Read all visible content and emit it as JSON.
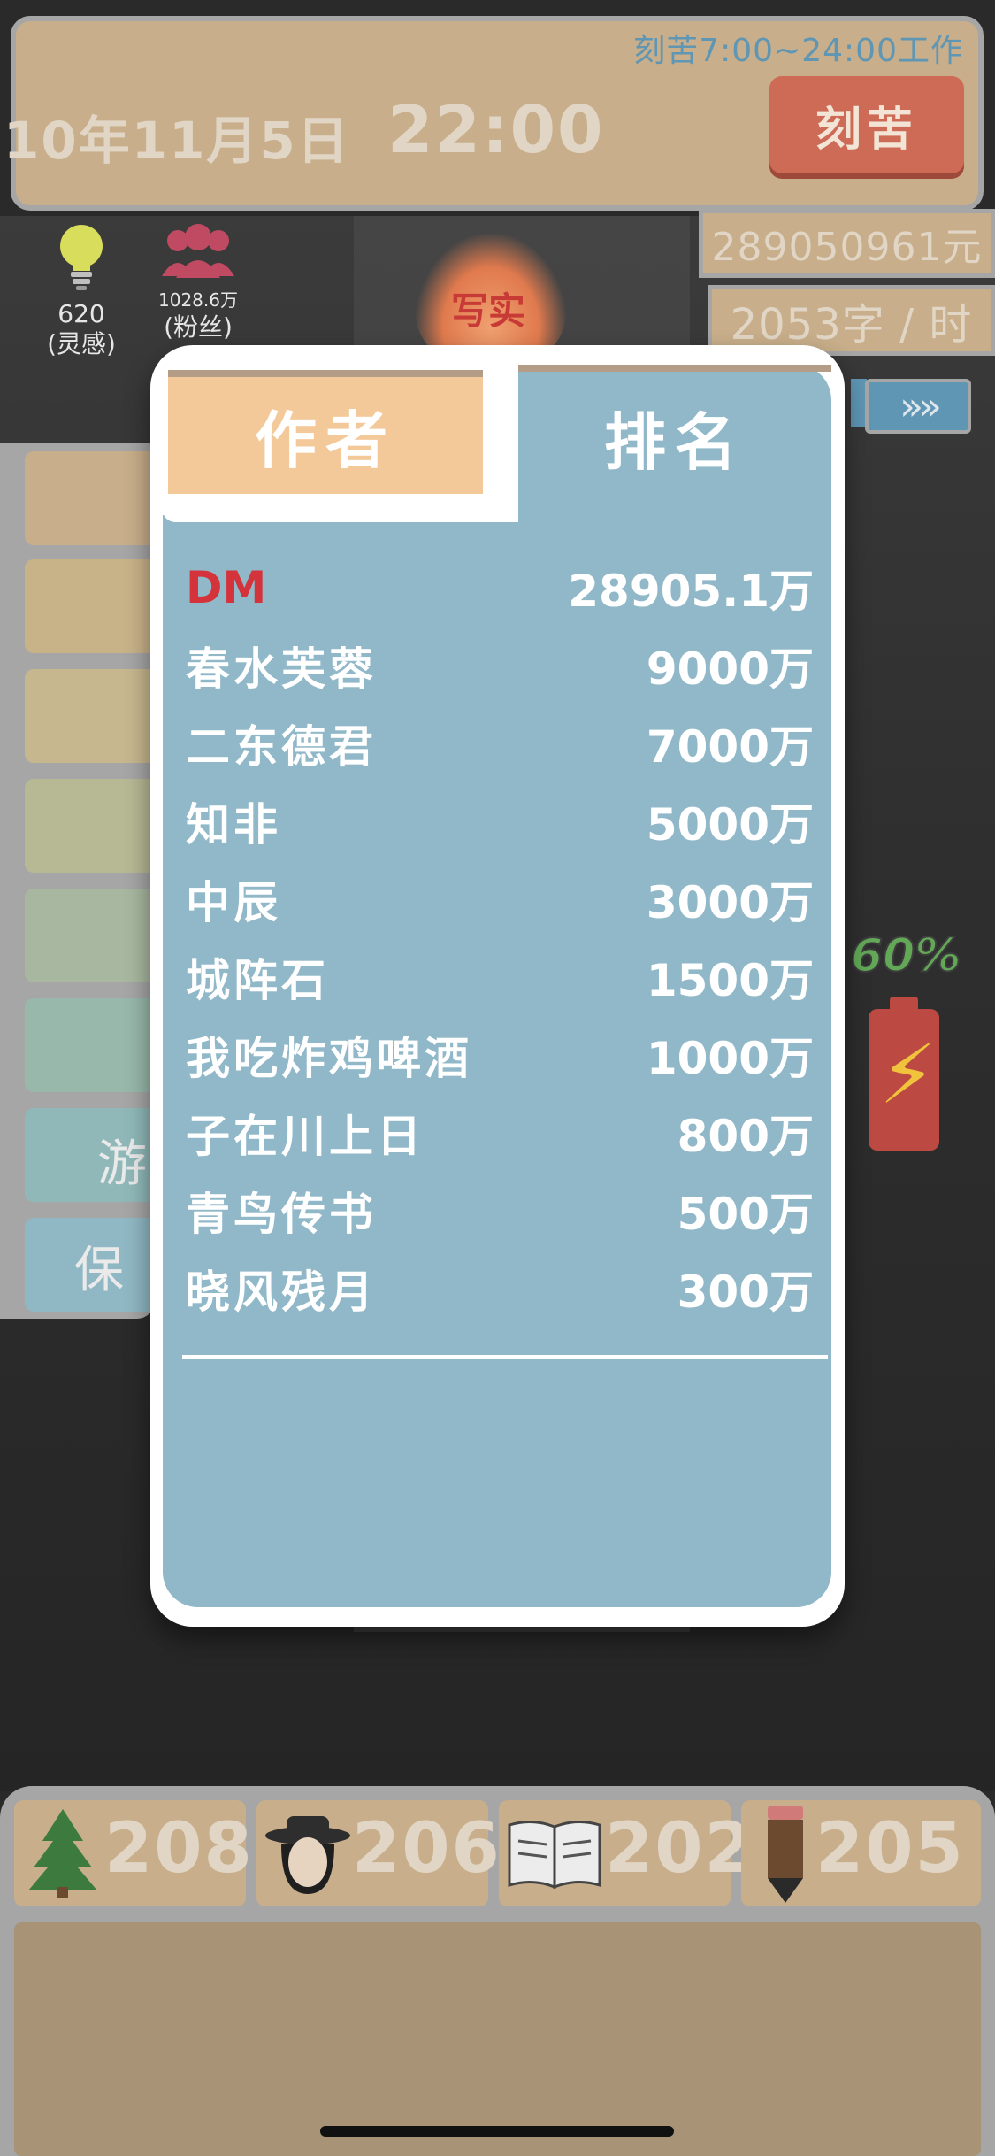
{
  "header": {
    "work_hours": "刻苦7:00~24:00工作",
    "date": "10年11月5日",
    "time": "22:00",
    "kegu_button": "刻苦"
  },
  "stats": {
    "money": "289050961元",
    "speed": "2053字 / 时",
    "inspiration_value": "620",
    "inspiration_label": "(灵感)",
    "fans_value": "1028.6万",
    "fans_label": "(粉丝)",
    "genre_label": "写实",
    "progress_percent": "60%",
    "arrows_icon": "»»"
  },
  "left_panel": {
    "item_1": "游",
    "item_2": "保"
  },
  "modal": {
    "tab_author": "作者",
    "tab_rank": "排名",
    "rankings": [
      {
        "name": "DM",
        "value": "28905.1万"
      },
      {
        "name": "春水芙蓉",
        "value": "9000万"
      },
      {
        "name": "二东德君",
        "value": "7000万"
      },
      {
        "name": "知非",
        "value": "5000万"
      },
      {
        "name": "中辰",
        "value": "3000万"
      },
      {
        "name": "城阵石",
        "value": "1500万"
      },
      {
        "name": "我吃炸鸡啤酒",
        "value": "1000万"
      },
      {
        "name": "子在川上日",
        "value": "800万"
      },
      {
        "name": "青鸟传书",
        "value": "500万"
      },
      {
        "name": "晓风残月",
        "value": "300万"
      }
    ]
  },
  "bottom": {
    "tree_value": "208",
    "character_value": "206",
    "book_value": "202",
    "pencil_value": "205"
  },
  "colors": {
    "panel_tan": "#c8ae8a",
    "frame_grey": "#a6a6a6",
    "accent_blue": "#90b8c8",
    "tab_orange": "#f4c99a",
    "button_red": "#cd6b57",
    "highlight_red": "#d4333b"
  }
}
